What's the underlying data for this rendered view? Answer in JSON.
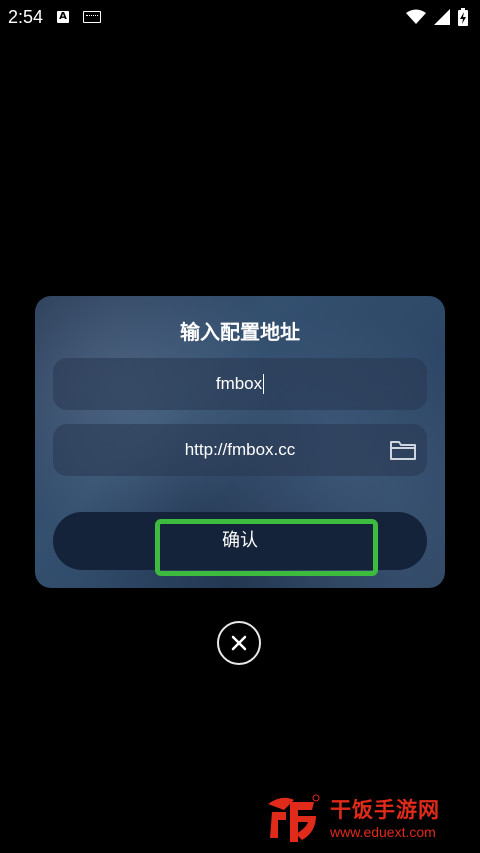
{
  "status_bar": {
    "time": "2:54",
    "icons": [
      "a-notification-icon",
      "keyboard-icon",
      "wifi-icon",
      "signal-icon",
      "battery-icon"
    ]
  },
  "dialog": {
    "title": "输入配置地址",
    "name_field_value": "fmbox",
    "url_field_value": "http://fmbox.cc",
    "confirm_label": "确认"
  },
  "watermark": {
    "title": "干饭手游网",
    "url": "www.eduext.com"
  },
  "colors": {
    "highlight": "#3dbb3e",
    "dialog_bg": "#2c4564",
    "button_bg": "#15233a",
    "watermark": "#e02a1a"
  }
}
